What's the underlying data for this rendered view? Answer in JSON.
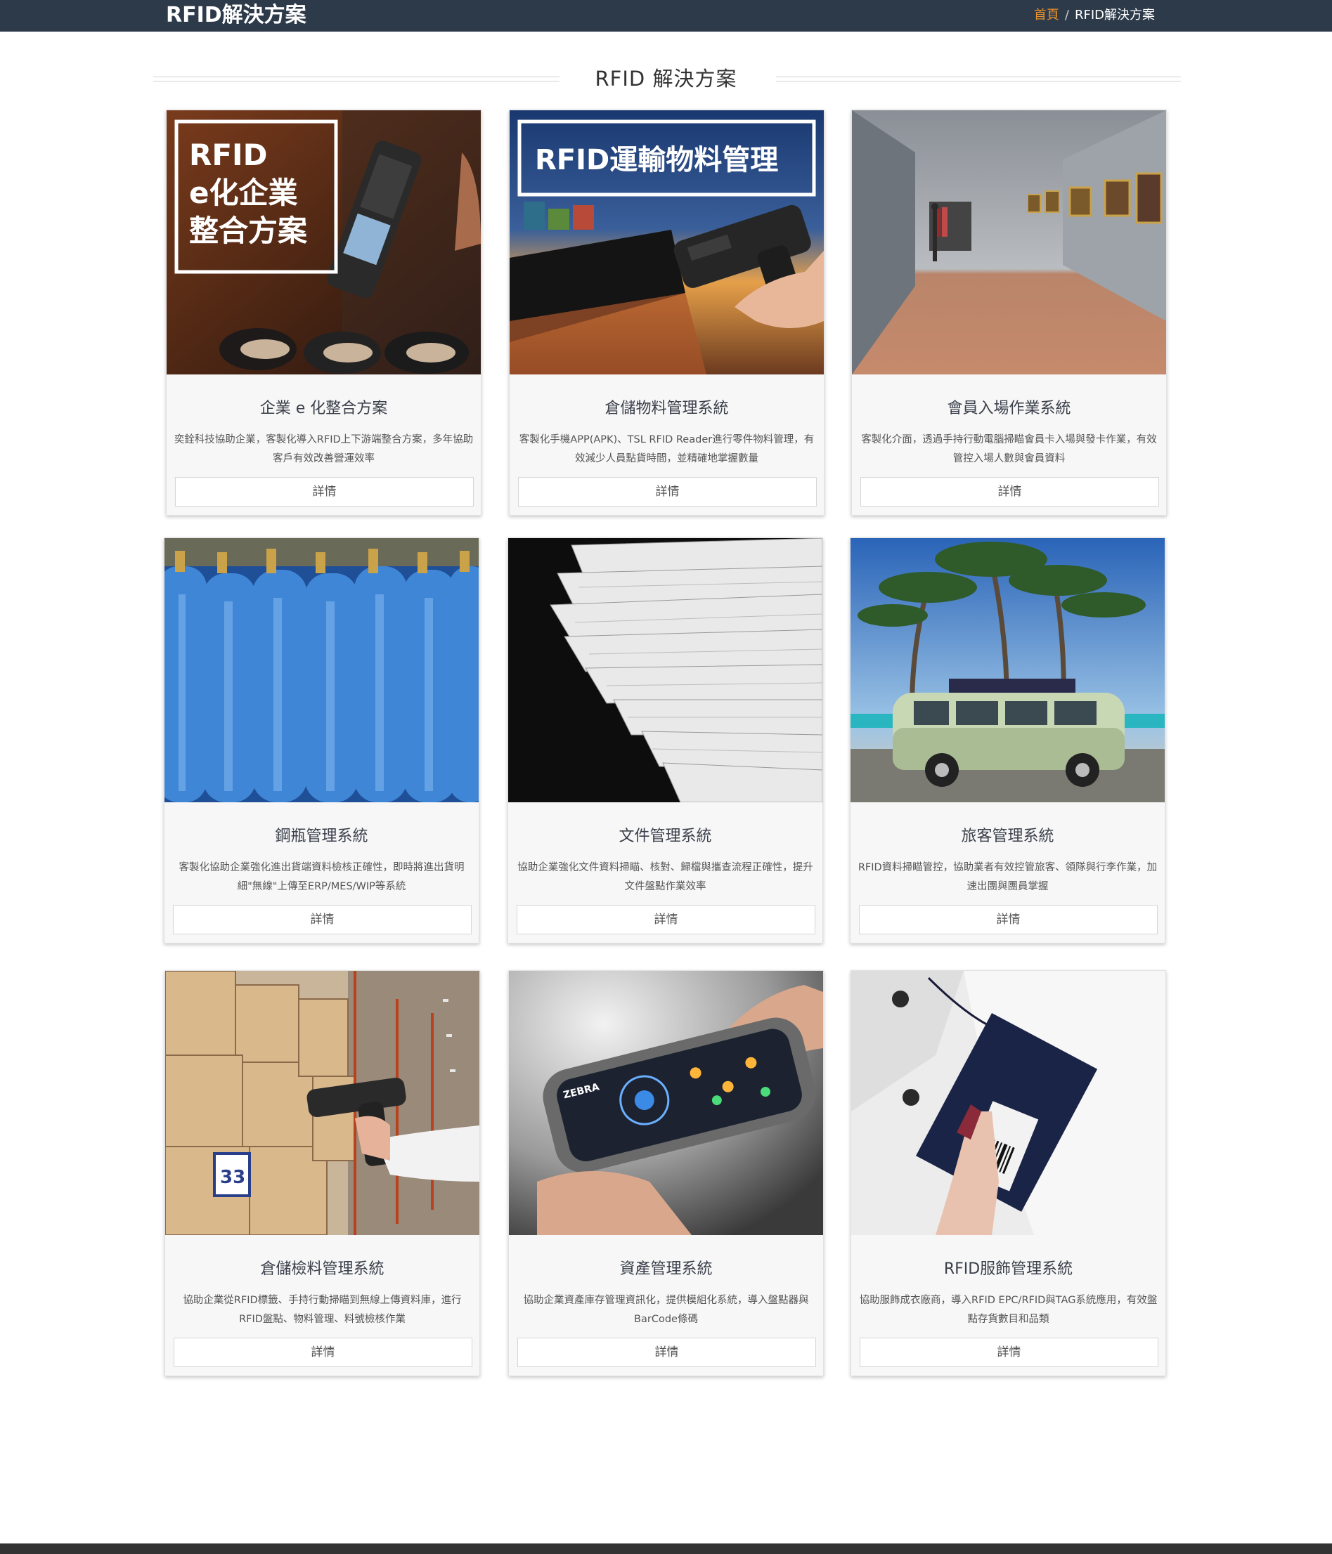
{
  "header": {
    "page_title": "RFID解決方案",
    "breadcrumb": {
      "home": "首頁",
      "separator": "/",
      "current": "RFID解決方案"
    }
  },
  "section": {
    "title": "RFID 解決方案"
  },
  "cards": [
    {
      "title": "企業 e 化整合方案",
      "desc": "奕銓科技協助企業，客製化導入RFID上下游端整合方案，多年協助客戶有效改善營運效率",
      "button": "詳情",
      "image_text": [
        "RFID",
        "e化企業",
        "整合方案"
      ]
    },
    {
      "title": "倉儲物料管理系統",
      "desc": "客製化手機APP(APK)、TSL RFID Reader進行零件物料管理，有效減少人員點貨時間，並精確地掌握數量",
      "button": "詳情",
      "image_text": [
        "RFID運輸物料管理"
      ]
    },
    {
      "title": "會員入場作業系統",
      "desc": "客製化介面，透過手持行動電腦掃瞄會員卡入場與發卡作業，有效管控入場人數與會員資料",
      "button": "詳情"
    },
    {
      "title": "鋼瓶管理系統",
      "desc": "客製化協助企業強化進出貨端資料檢核正確性，即時將進出貨明細\"無線\"上傳至ERP/MES/WIP等系統",
      "button": "詳情"
    },
    {
      "title": "文件管理系統",
      "desc": "協助企業強化文件資料掃瞄、核對、歸檔與攜查流程正確性，提升文件盤點作業效率",
      "button": "詳情"
    },
    {
      "title": "旅客管理系統",
      "desc": "RFID資料掃瞄管控，協助業者有效控管旅客、領隊與行李作業，加速出團與團員掌握",
      "button": "詳情"
    },
    {
      "title": "倉儲檢料管理系統",
      "desc": "協助企業從RFID標籤、手持行動掃瞄到無線上傳資料庫，進行RFID盤點、物料管理、料號檢核作業",
      "button": "詳情",
      "image_text": [
        "33"
      ]
    },
    {
      "title": "資產管理系統",
      "desc": "協助企業資產庫存管理資訊化，提供模組化系統，導入盤點器與BarCode條碼",
      "button": "詳情",
      "image_text": [
        "ZEBRA"
      ]
    },
    {
      "title": "RFID服飾管理系統",
      "desc": "協助服飾成衣廠商，導入RFID EPC/RFID與TAG系統應用，有效盤點存貨數目和品類",
      "button": "詳情"
    }
  ],
  "colors": {
    "header_bg": "#2d3a4a",
    "breadcrumb_home": "#e8902c",
    "card_bg": "#f7f7f7",
    "footer_bg": "#333333"
  }
}
